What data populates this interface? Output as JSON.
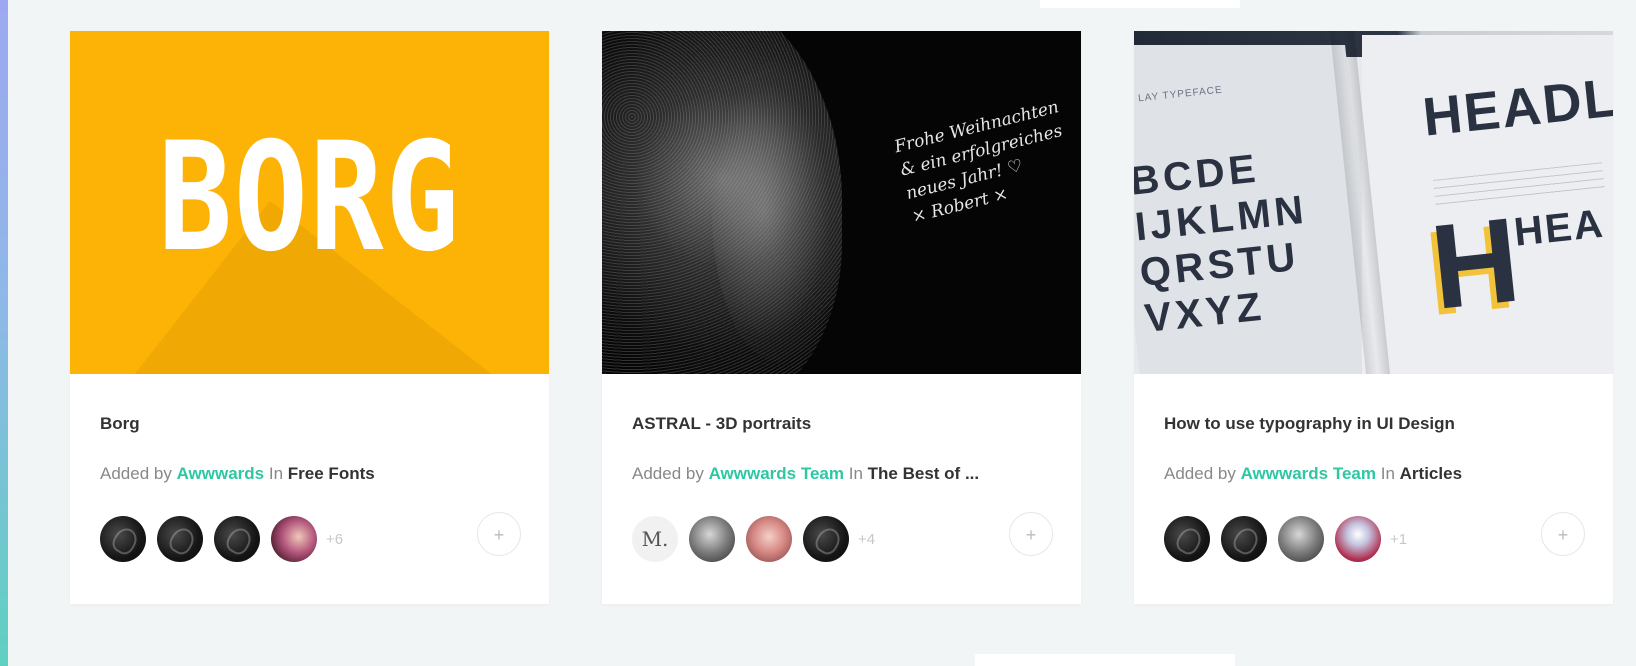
{
  "cards": [
    {
      "thumb_text": "BORG",
      "title": "Borg",
      "added_by_prefix": "Added by",
      "author": "Awwwards",
      "in_word": "In",
      "collection": "Free Fonts",
      "more_count": "+6",
      "add_icon": "+"
    },
    {
      "thumb_text": "Frohe Weihnachten\n& ein erfolgreiches\nneues Jahr! ♡\n× Robert ×",
      "title": "ASTRAL - 3D portraits",
      "added_by_prefix": "Added by",
      "author": "Awwwards Team",
      "in_word": "In",
      "collection": "The Best of ...",
      "avatar_letter": "M.",
      "more_count": "+4",
      "add_icon": "+"
    },
    {
      "thumb_tag": "LAY TYPEFACE",
      "thumb_letters": "BCDE\nIJKLMN\nQRSTU\nVXYZ",
      "thumb_headline": "HEADL",
      "thumb_big_letter": "H",
      "thumb_small_word": "HEA",
      "title": "How to use typography in UI Design",
      "added_by_prefix": "Added by",
      "author": "Awwwards Team",
      "in_word": "In",
      "collection": "Articles",
      "more_count": "+1",
      "add_icon": "+"
    }
  ],
  "colors": {
    "accent": "#2dc7a3",
    "borg_yellow": "#fdb305"
  }
}
